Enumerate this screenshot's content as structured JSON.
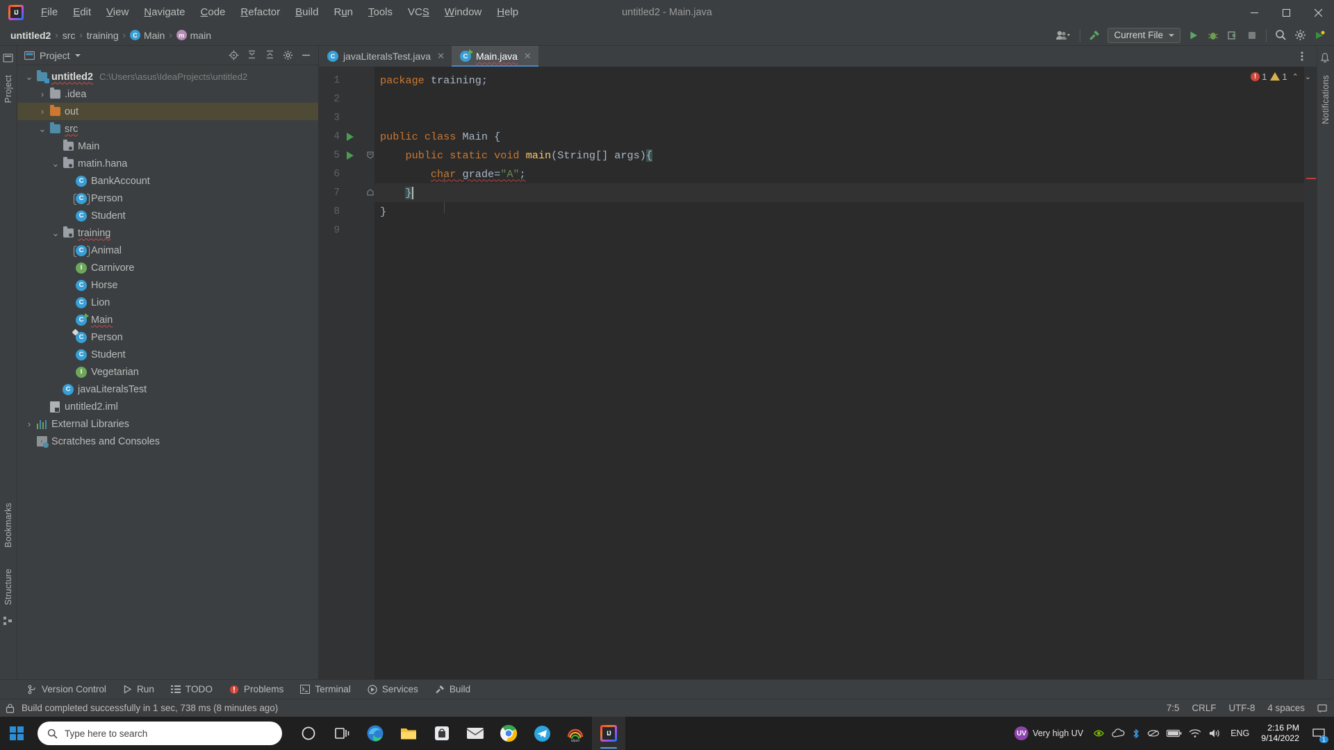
{
  "window": {
    "title": "untitled2 - Main.java",
    "logo_text": "IJ",
    "minimize": "─",
    "maximize": "❐",
    "close": "✕"
  },
  "menu": {
    "items": [
      {
        "label": "File",
        "accel": "F"
      },
      {
        "label": "Edit",
        "accel": "E"
      },
      {
        "label": "View",
        "accel": "V"
      },
      {
        "label": "Navigate",
        "accel": "N"
      },
      {
        "label": "Code",
        "accel": "C"
      },
      {
        "label": "Refactor",
        "accel": "R"
      },
      {
        "label": "Build",
        "accel": "B"
      },
      {
        "label": "Run",
        "accel": "u"
      },
      {
        "label": "Tools",
        "accel": "T"
      },
      {
        "label": "VCS",
        "accel": "S"
      },
      {
        "label": "Window",
        "accel": "W"
      },
      {
        "label": "Help",
        "accel": "H"
      }
    ]
  },
  "breadcrumb": {
    "items": [
      {
        "label": "untitled2",
        "icon": "",
        "bold": true
      },
      {
        "label": "src",
        "icon": ""
      },
      {
        "label": "training",
        "icon": ""
      },
      {
        "label": "Main",
        "icon": "class-icon"
      },
      {
        "label": "main",
        "icon": "method-icon"
      }
    ],
    "separator": "›"
  },
  "toolbar": {
    "run_config": "Current File",
    "icons": [
      "user-avatar-icon",
      "build-hammer-icon",
      "run-icon",
      "debug-icon",
      "run-coverage-icon",
      "stop-icon",
      "search-everywhere-icon",
      "settings-gear-icon"
    ]
  },
  "left_strip": {
    "labels": [
      "Project",
      "Bookmarks",
      "Structure"
    ]
  },
  "right_strip": {
    "labels": [
      "Notifications"
    ]
  },
  "project_panel": {
    "title": "Project",
    "header_icons": [
      "target-locate-icon",
      "expand-all-icon",
      "collapse-all-icon",
      "settings-gear-icon",
      "hide-icon"
    ],
    "tree": [
      {
        "indent": 0,
        "arrow": "down",
        "icon": "module-folder",
        "label": "untitled2",
        "bold": true,
        "squiggly": true,
        "sub": "C:\\Users\\asus\\IdeaProjects\\untitled2"
      },
      {
        "indent": 1,
        "arrow": "right",
        "icon": "folder-gray",
        "label": ".idea"
      },
      {
        "indent": 1,
        "arrow": "right",
        "icon": "folder-orange",
        "label": "out",
        "selected": true
      },
      {
        "indent": 1,
        "arrow": "down",
        "icon": "folder-source",
        "label": "src",
        "squiggly": true
      },
      {
        "indent": 2,
        "arrow": "",
        "icon": "package-icon",
        "label": "Main"
      },
      {
        "indent": 2,
        "arrow": "down",
        "icon": "package-icon",
        "label": "matin.hana"
      },
      {
        "indent": 3,
        "arrow": "",
        "icon": "class-icon",
        "label": "BankAccount"
      },
      {
        "indent": 3,
        "arrow": "",
        "icon": "abstract-class-icon",
        "label": "Person"
      },
      {
        "indent": 3,
        "arrow": "",
        "icon": "class-icon",
        "label": "Student"
      },
      {
        "indent": 2,
        "arrow": "down",
        "icon": "package-icon",
        "label": "training",
        "squiggly": true
      },
      {
        "indent": 3,
        "arrow": "",
        "icon": "abstract-class-icon",
        "label": "Animal"
      },
      {
        "indent": 3,
        "arrow": "",
        "icon": "interface-icon",
        "label": "Carnivore"
      },
      {
        "indent": 3,
        "arrow": "",
        "icon": "class-icon",
        "label": "Horse"
      },
      {
        "indent": 3,
        "arrow": "",
        "icon": "class-icon",
        "label": "Lion"
      },
      {
        "indent": 3,
        "arrow": "",
        "icon": "class-runnable-icon",
        "label": "Main",
        "squiggly": true
      },
      {
        "indent": 3,
        "arrow": "",
        "icon": "class-modified-icon",
        "label": "Person"
      },
      {
        "indent": 3,
        "arrow": "",
        "icon": "class-icon",
        "label": "Student"
      },
      {
        "indent": 3,
        "arrow": "",
        "icon": "interface-icon",
        "label": "Vegetarian"
      },
      {
        "indent": 2,
        "arrow": "",
        "icon": "class-icon",
        "label": "javaLiteralsTest"
      },
      {
        "indent": 1,
        "arrow": "",
        "icon": "iml-file-icon",
        "label": "untitled2.iml"
      },
      {
        "indent": 0,
        "arrow": "right",
        "icon": "library-icon",
        "label": "External Libraries"
      },
      {
        "indent": 0,
        "arrow": "",
        "icon": "scratches-icon",
        "label": "Scratches and Consoles"
      }
    ]
  },
  "editor": {
    "tabs": [
      {
        "label": "javaLiteralsTest.java",
        "icon": "class-icon",
        "active": false,
        "close": "✕"
      },
      {
        "label": "Main.java",
        "icon": "class-runnable-icon",
        "active": true,
        "close": "✕",
        "squiggly": true
      }
    ],
    "lines": [
      {
        "num": "1",
        "run": false,
        "fold": "",
        "tokens": [
          {
            "t": "package",
            "c": "kw"
          },
          {
            "t": " ",
            "c": "pln"
          },
          {
            "t": "training",
            "c": "pln"
          },
          {
            "t": ";",
            "c": "pln"
          }
        ]
      },
      {
        "num": "2",
        "run": false,
        "fold": "",
        "tokens": []
      },
      {
        "num": "3",
        "run": false,
        "fold": "",
        "tokens": []
      },
      {
        "num": "4",
        "run": true,
        "fold": "",
        "tokens": [
          {
            "t": "public",
            "c": "kw"
          },
          {
            "t": " ",
            "c": "pln"
          },
          {
            "t": "class",
            "c": "kw"
          },
          {
            "t": " ",
            "c": "pln"
          },
          {
            "t": "Main",
            "c": "cls-n"
          },
          {
            "t": " {",
            "c": "pln"
          }
        ]
      },
      {
        "num": "5",
        "run": true,
        "fold": "minus",
        "tokens": [
          {
            "t": "    ",
            "c": "pln"
          },
          {
            "t": "public",
            "c": "kw"
          },
          {
            "t": " ",
            "c": "pln"
          },
          {
            "t": "static",
            "c": "kw"
          },
          {
            "t": " ",
            "c": "pln"
          },
          {
            "t": "void",
            "c": "kw"
          },
          {
            "t": " ",
            "c": "pln"
          },
          {
            "t": "main",
            "c": "mth"
          },
          {
            "t": "(String[] args)",
            "c": "pln"
          },
          {
            "t": "{",
            "c": "brace-hl"
          }
        ]
      },
      {
        "num": "6",
        "run": false,
        "fold": "",
        "tokens": [
          {
            "t": "        ",
            "c": "pln"
          },
          {
            "t": "char",
            "c": "kw wavy"
          },
          {
            "t": " grade=",
            "c": "pln wavy"
          },
          {
            "t": "\"A\"",
            "c": "str wavy"
          },
          {
            "t": ";",
            "c": "pln wavy"
          }
        ]
      },
      {
        "num": "7",
        "run": false,
        "fold": "end",
        "current": true,
        "tokens": [
          {
            "t": "    ",
            "c": "pln"
          },
          {
            "t": "}",
            "c": "brace-hl"
          }
        ]
      },
      {
        "num": "8",
        "run": false,
        "fold": "",
        "tokens": [
          {
            "t": "}",
            "c": "pln"
          }
        ]
      },
      {
        "num": "9",
        "run": false,
        "fold": "",
        "tokens": []
      }
    ],
    "inspection": {
      "error_count": "1",
      "warning_count": "1",
      "up_arrow": "⌃",
      "down_arrow": "⌄"
    }
  },
  "tool_windows": {
    "items": [
      {
        "label": "Version Control",
        "icon": "branch-icon"
      },
      {
        "label": "Run",
        "icon": "run-icon"
      },
      {
        "label": "TODO",
        "icon": "list-icon"
      },
      {
        "label": "Problems",
        "icon": "error-icon"
      },
      {
        "label": "Terminal",
        "icon": "terminal-icon"
      },
      {
        "label": "Services",
        "icon": "services-icon"
      },
      {
        "label": "Build",
        "icon": "hammer-icon"
      }
    ]
  },
  "status_bar": {
    "message": "Build completed successfully in 1 sec, 738 ms (8 minutes ago)",
    "caret_position": "7:5",
    "line_separator": "CRLF",
    "encoding": "UTF-8",
    "indent": "4 spaces",
    "lock_icon": "lock-icon"
  },
  "taskbar": {
    "search_placeholder": "Type here to search",
    "apps": [
      {
        "name": "cortana-icon"
      },
      {
        "name": "task-view-icon"
      },
      {
        "name": "microsoft-edge-icon"
      },
      {
        "name": "file-explorer-icon"
      },
      {
        "name": "microsoft-store-icon"
      },
      {
        "name": "mail-icon"
      },
      {
        "name": "google-chrome-icon"
      },
      {
        "name": "telegram-icon"
      },
      {
        "name": "alpari-icon",
        "label": "alpari"
      },
      {
        "name": "intellij-idea-icon",
        "active": true
      }
    ],
    "tray": {
      "uv_label": "Very high UV",
      "uv_badge": "UV",
      "language": "ENG",
      "time": "2:16 PM",
      "date": "9/14/2022",
      "notification_count": "1"
    }
  }
}
